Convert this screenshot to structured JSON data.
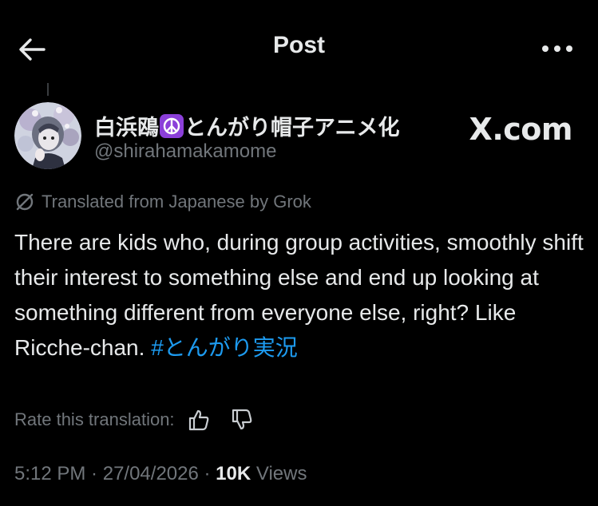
{
  "header": {
    "title": "Post",
    "back_icon": "arrow-left-icon",
    "more_icon": "more-horizontal-icon"
  },
  "author": {
    "display_name_part1": "白浜鴎",
    "badge_icon": "peace-symbol-icon",
    "display_name_part2": "とんがり帽子アニメ化",
    "handle": "@shirahamakamome",
    "avatar_icon": "avatar-illustration"
  },
  "watermark": "X.com",
  "translation": {
    "notice": "Translated from Japanese by Grok",
    "icon": "translate-slash-icon"
  },
  "post": {
    "text": "There are kids who, during group activities, smoothly shift their interest to something else and end up looking at something different from everyone else, right? Like Ricche-chan. ",
    "hashtag": "#とんがり実況"
  },
  "rating": {
    "label": "Rate this translation:",
    "like_icon": "thumbs-up-icon",
    "dislike_icon": "thumbs-down-icon"
  },
  "meta": {
    "time": "5:12 PM",
    "separator": " · ",
    "date": "27/04/2026",
    "views_count": "10K",
    "views_label": "Views"
  },
  "colors": {
    "background": "#000000",
    "text": "#e7e9ea",
    "muted": "#71767b",
    "link": "#1d9bf0",
    "badge": "#8b3fd9"
  }
}
